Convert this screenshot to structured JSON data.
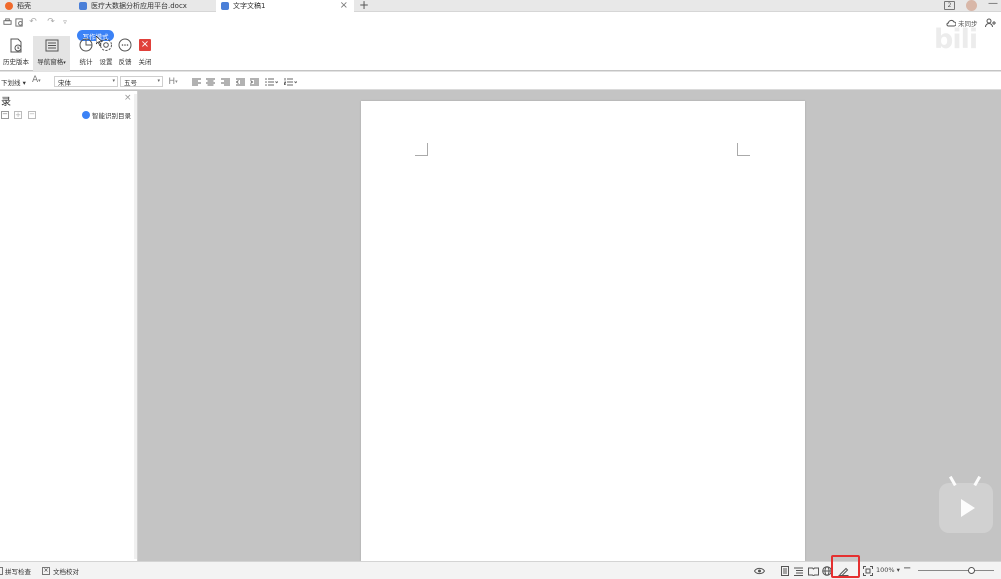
{
  "tabs": [
    {
      "label": "稻壳"
    },
    {
      "label": "医疗大数据分析应用平台.docx"
    },
    {
      "label": "文字文稿1"
    }
  ],
  "ribbon": {
    "mode_label": "写作模式",
    "buttons": [
      {
        "label": "历史版本"
      },
      {
        "label": "导航窗格"
      },
      {
        "label": "统计"
      },
      {
        "label": "设置"
      },
      {
        "label": "反馈"
      },
      {
        "label": "关闭"
      }
    ],
    "right_label": "未同步"
  },
  "format": {
    "underline_label": "下划线",
    "font_family": "宋体",
    "font_size": "五号"
  },
  "nav_panel": {
    "title": "录",
    "smart_toc_label": "智能识别目录"
  },
  "status": {
    "spell_check": "拼写检查",
    "doc_proof": "文档校对",
    "zoom": "100%",
    "zoom_level": 0.7
  },
  "colors": {
    "accent": "#3b82f6",
    "close_red": "#e0403a",
    "highlight": "#e53030"
  },
  "icons": [
    "history-icon",
    "nav-pane-icon",
    "stats-icon",
    "settings-icon",
    "feedback-icon",
    "close-icon",
    "ai-icon",
    "eye-icon",
    "play-icon"
  ]
}
